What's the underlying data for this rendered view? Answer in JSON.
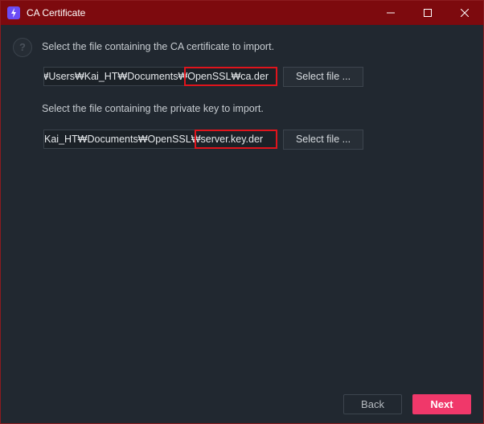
{
  "window": {
    "title": "CA Certificate",
    "icon": "lightning-bolt-icon"
  },
  "titlebar_controls": {
    "minimize_icon": "minimize-icon",
    "maximize_icon": "maximize-icon",
    "close_icon": "close-icon"
  },
  "help": {
    "icon": "question-mark-icon",
    "glyph": "?"
  },
  "ca_certificate": {
    "prompt": "Select the file containing the CA certificate to import.",
    "path_value": "₩Users₩Kai_HT₩Documents₩OpenSSL₩ca.der",
    "select_label": "Select file ..."
  },
  "private_key": {
    "prompt": "Select the file containing the private key to import.",
    "path_value": "Kai_HT₩Documents₩OpenSSL₩server.key.der",
    "select_label": "Select file ..."
  },
  "footer": {
    "back_label": "Back",
    "next_label": "Next"
  },
  "colors": {
    "titlebar": "#7d0a0e",
    "background": "#212830",
    "accent": "#f0386a",
    "highlight_box": "#e0141c"
  }
}
